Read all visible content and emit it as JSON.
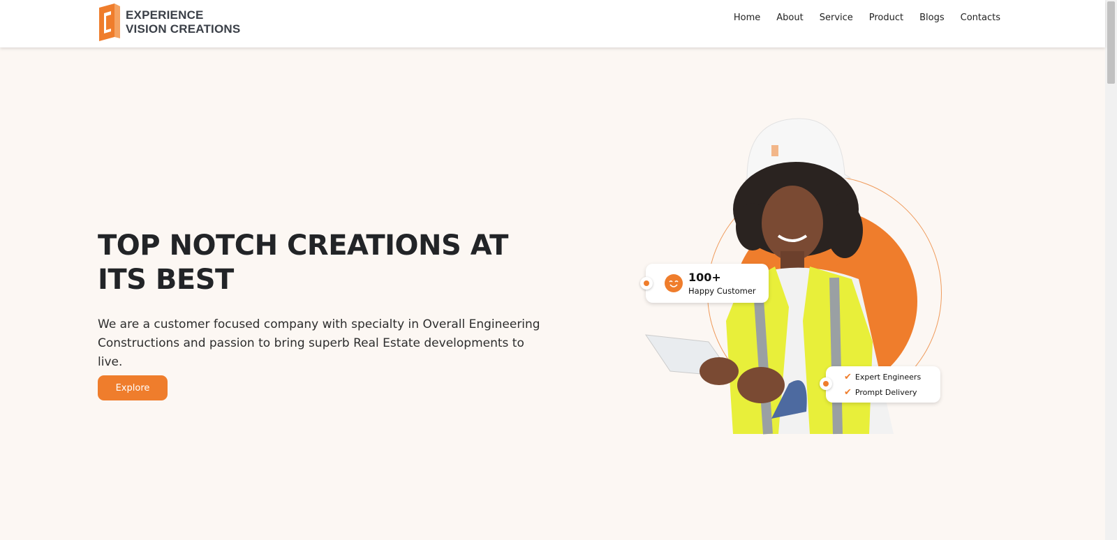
{
  "brand": {
    "line1": "EXPERIENCE",
    "line2": "VISION CREATIONS",
    "accent": "#ef7d2c"
  },
  "nav": {
    "items": [
      "Home",
      "About",
      "Service",
      "Product",
      "Blogs",
      "Contacts"
    ]
  },
  "hero": {
    "title_line1": "TOP NOTCH CREATIONS AT",
    "title_line2": "ITS BEST",
    "description_line1": "We are a customer focused company with specialty in Overall Engineering",
    "description_line2": "Constructions and passion to bring superb Real Estate developments to live.",
    "cta_label": "Explore"
  },
  "stat_card": {
    "number": "100+",
    "label": "Happy Customer",
    "icon": "smile-icon"
  },
  "feature_card": {
    "items": [
      "Expert Engineers",
      "Prompt Delivery"
    ],
    "icon": "check-icon"
  }
}
